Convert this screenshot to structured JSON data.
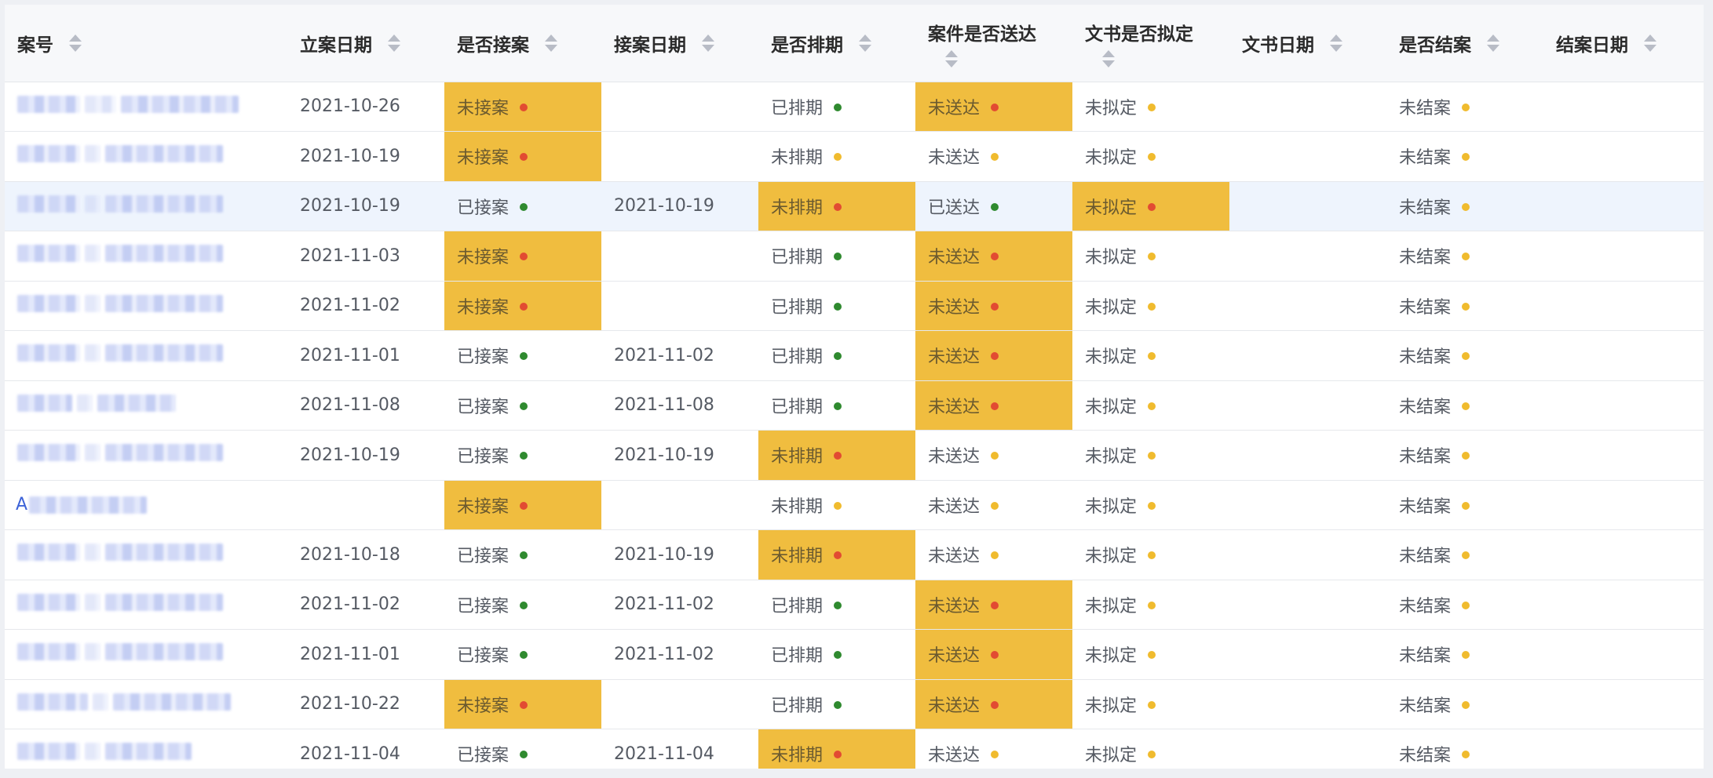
{
  "table": {
    "headers": {
      "case_no": "案号",
      "filing_date": "立案日期",
      "accepted": "是否接案",
      "accept_date": "接案日期",
      "scheduled": "是否排期",
      "delivered": "案件是否送达",
      "drafted": "文书是否拟定",
      "doc_date": "文书日期",
      "closed": "是否结案",
      "close_date": "结案日期"
    },
    "rows": [
      {
        "case_no": "",
        "filing_date": "2021-10-26",
        "accepted": "未接案",
        "accepted_status": "red",
        "accept_date": "",
        "scheduled": "已排期",
        "scheduled_status": "green",
        "delivered": "未送达",
        "delivered_status": "red",
        "drafted": "未拟定",
        "drafted_status": "yellow",
        "doc_date": "",
        "closed": "未结案",
        "closed_status": "yellow",
        "close_date": ""
      },
      {
        "case_no": "",
        "filing_date": "2021-10-19",
        "accepted": "未接案",
        "accepted_status": "red",
        "accept_date": "",
        "scheduled": "未排期",
        "scheduled_status": "yellow",
        "delivered": "未送达",
        "delivered_status": "yellow",
        "drafted": "未拟定",
        "drafted_status": "yellow",
        "doc_date": "",
        "closed": "未结案",
        "closed_status": "yellow",
        "close_date": ""
      },
      {
        "case_no": "",
        "filing_date": "2021-10-19",
        "accepted": "已接案",
        "accepted_status": "green",
        "accept_date": "2021-10-19",
        "scheduled": "未排期",
        "scheduled_status": "red",
        "delivered": "已送达",
        "delivered_status": "green",
        "drafted": "未拟定",
        "drafted_status": "red",
        "doc_date": "",
        "closed": "未结案",
        "closed_status": "yellow",
        "close_date": ""
      },
      {
        "case_no": "",
        "filing_date": "2021-11-03",
        "accepted": "未接案",
        "accepted_status": "red",
        "accept_date": "",
        "scheduled": "已排期",
        "scheduled_status": "green",
        "delivered": "未送达",
        "delivered_status": "red",
        "drafted": "未拟定",
        "drafted_status": "yellow",
        "doc_date": "",
        "closed": "未结案",
        "closed_status": "yellow",
        "close_date": ""
      },
      {
        "case_no": "",
        "filing_date": "2021-11-02",
        "accepted": "未接案",
        "accepted_status": "red",
        "accept_date": "",
        "scheduled": "已排期",
        "scheduled_status": "green",
        "delivered": "未送达",
        "delivered_status": "red",
        "drafted": "未拟定",
        "drafted_status": "yellow",
        "doc_date": "",
        "closed": "未结案",
        "closed_status": "yellow",
        "close_date": ""
      },
      {
        "case_no": "",
        "filing_date": "2021-11-01",
        "accepted": "已接案",
        "accepted_status": "green",
        "accept_date": "2021-11-02",
        "scheduled": "已排期",
        "scheduled_status": "green",
        "delivered": "未送达",
        "delivered_status": "red",
        "drafted": "未拟定",
        "drafted_status": "yellow",
        "doc_date": "",
        "closed": "未结案",
        "closed_status": "yellow",
        "close_date": ""
      },
      {
        "case_no": "",
        "filing_date": "2021-11-08",
        "accepted": "已接案",
        "accepted_status": "green",
        "accept_date": "2021-11-08",
        "scheduled": "已排期",
        "scheduled_status": "green",
        "delivered": "未送达",
        "delivered_status": "red",
        "drafted": "未拟定",
        "drafted_status": "yellow",
        "doc_date": "",
        "closed": "未结案",
        "closed_status": "yellow",
        "close_date": ""
      },
      {
        "case_no": "",
        "filing_date": "2021-10-19",
        "accepted": "已接案",
        "accepted_status": "green",
        "accept_date": "2021-10-19",
        "scheduled": "未排期",
        "scheduled_status": "red",
        "delivered": "未送达",
        "delivered_status": "yellow",
        "drafted": "未拟定",
        "drafted_status": "yellow",
        "doc_date": "",
        "closed": "未结案",
        "closed_status": "yellow",
        "close_date": ""
      },
      {
        "case_no": "A",
        "filing_date": "",
        "accepted": "未接案",
        "accepted_status": "red",
        "accept_date": "",
        "scheduled": "未排期",
        "scheduled_status": "yellow",
        "delivered": "未送达",
        "delivered_status": "yellow",
        "drafted": "未拟定",
        "drafted_status": "yellow",
        "doc_date": "",
        "closed": "未结案",
        "closed_status": "yellow",
        "close_date": ""
      },
      {
        "case_no": "",
        "filing_date": "2021-10-18",
        "accepted": "已接案",
        "accepted_status": "green",
        "accept_date": "2021-10-19",
        "scheduled": "未排期",
        "scheduled_status": "red",
        "delivered": "未送达",
        "delivered_status": "yellow",
        "drafted": "未拟定",
        "drafted_status": "yellow",
        "doc_date": "",
        "closed": "未结案",
        "closed_status": "yellow",
        "close_date": ""
      },
      {
        "case_no": "",
        "filing_date": "2021-11-02",
        "accepted": "已接案",
        "accepted_status": "green",
        "accept_date": "2021-11-02",
        "scheduled": "已排期",
        "scheduled_status": "green",
        "delivered": "未送达",
        "delivered_status": "red",
        "drafted": "未拟定",
        "drafted_status": "yellow",
        "doc_date": "",
        "closed": "未结案",
        "closed_status": "yellow",
        "close_date": ""
      },
      {
        "case_no": "",
        "filing_date": "2021-11-01",
        "accepted": "已接案",
        "accepted_status": "green",
        "accept_date": "2021-11-02",
        "scheduled": "已排期",
        "scheduled_status": "green",
        "delivered": "未送达",
        "delivered_status": "red",
        "drafted": "未拟定",
        "drafted_status": "yellow",
        "doc_date": "",
        "closed": "未结案",
        "closed_status": "yellow",
        "close_date": ""
      },
      {
        "case_no": "",
        "filing_date": "2021-10-22",
        "accepted": "未接案",
        "accepted_status": "red",
        "accept_date": "",
        "scheduled": "已排期",
        "scheduled_status": "green",
        "delivered": "未送达",
        "delivered_status": "red",
        "drafted": "未拟定",
        "drafted_status": "yellow",
        "doc_date": "",
        "closed": "未结案",
        "closed_status": "yellow",
        "close_date": ""
      },
      {
        "case_no": "",
        "filing_date": "2021-11-04",
        "accepted": "已接案",
        "accepted_status": "green",
        "accept_date": "2021-11-04",
        "scheduled": "未排期",
        "scheduled_status": "red",
        "delivered": "未送达",
        "delivered_status": "yellow",
        "drafted": "未拟定",
        "drafted_status": "yellow",
        "doc_date": "",
        "closed": "未结案",
        "closed_status": "yellow",
        "close_date": ""
      }
    ]
  },
  "colors": {
    "warn_bg": "#f0bd3f",
    "dot_red": "#e24b32",
    "dot_green": "#2f8a2f",
    "dot_yellow": "#f0bb2e",
    "link": "#3d63d8"
  }
}
